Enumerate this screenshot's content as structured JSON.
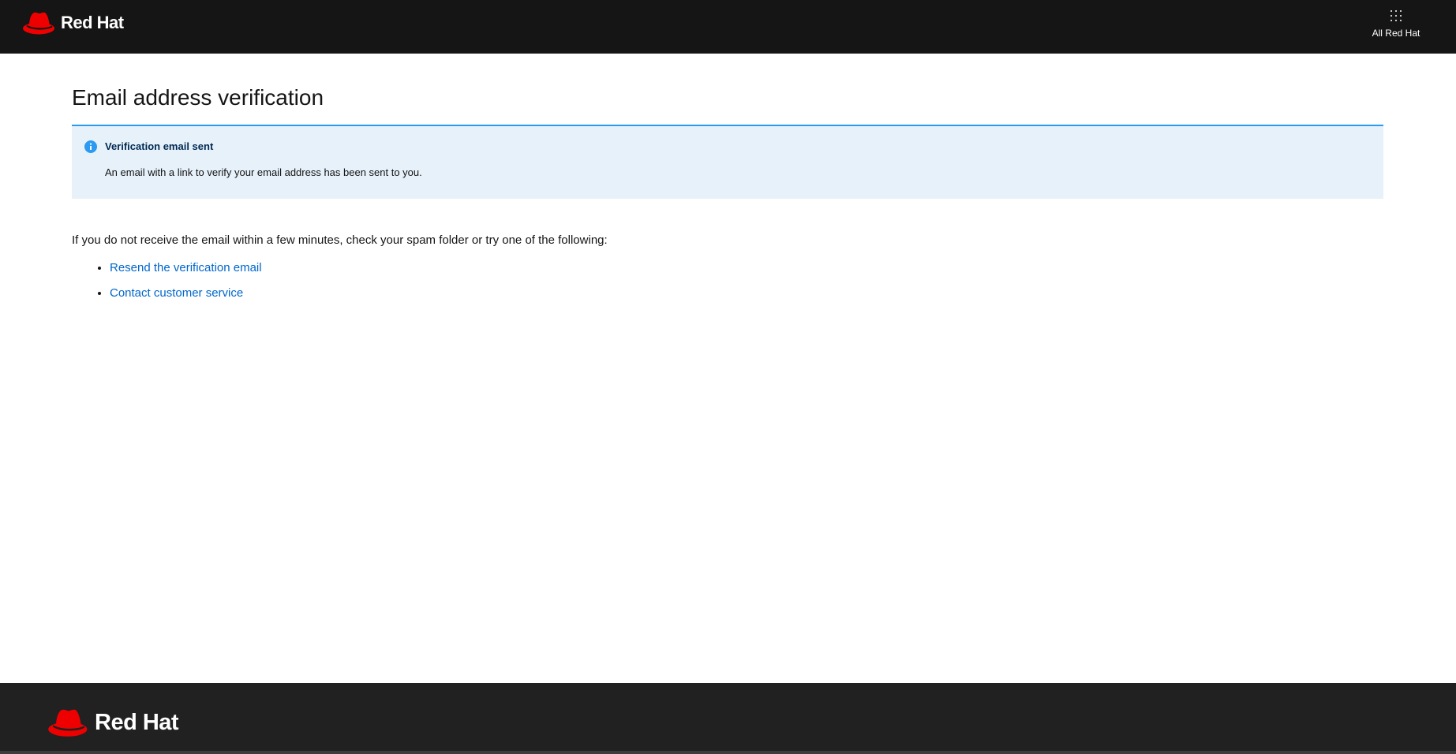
{
  "header": {
    "brand_name": "Red Hat",
    "all_red_hat_label": "All Red Hat"
  },
  "main": {
    "title": "Email address verification",
    "alert": {
      "title": "Verification email sent",
      "description": "An email with a link to verify your email address has been sent to you."
    },
    "instructions": "If you do not receive the email within a few minutes, check your spam folder or try one of the following:",
    "options": [
      {
        "label": "Resend the verification email"
      },
      {
        "label": "Contact customer service"
      }
    ]
  },
  "footer": {
    "brand_name": "Red Hat"
  },
  "colors": {
    "brand_red": "#ee0000",
    "header_bg": "#151515",
    "footer_bg": "#212121",
    "link": "#0066cc",
    "alert_bg": "#e7f1fa",
    "alert_border": "#2b9af3"
  },
  "icons": {
    "brand": "redhat-hat-icon",
    "apps": "grid-icon",
    "alert": "info-circle-icon"
  }
}
